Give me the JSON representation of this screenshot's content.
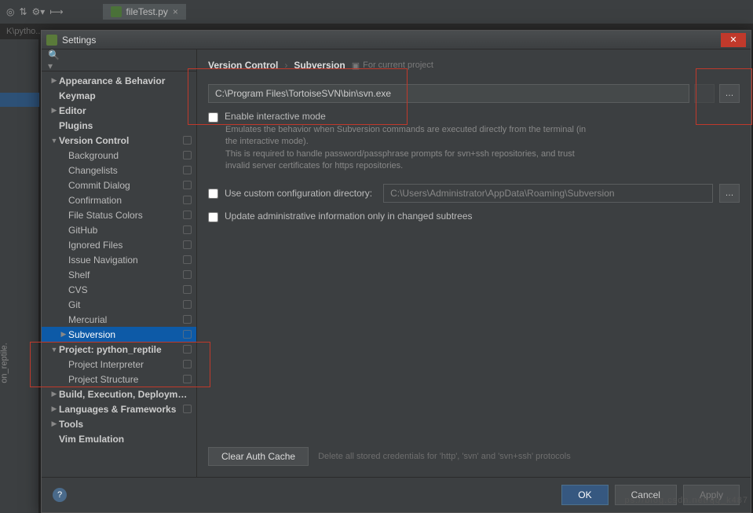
{
  "top": {
    "file_tab": "fileTest.py",
    "breadcrumb_partial": "K\\pytho..."
  },
  "gutter_label": "on_reptile.",
  "dialog": {
    "title": "Settings",
    "search_placeholder": "",
    "breadcrumb": {
      "root": "Version Control",
      "leaf": "Subversion",
      "tag": "For current project"
    },
    "svn_path": "C:\\Program Files\\TortoiseSVN\\bin\\svn.exe",
    "enable_interactive_label": "Enable interactive mode",
    "interactive_help": "Emulates the behavior when Subversion commands are executed directly from the terminal (in the interactive mode).\nThis is required to handle password/passphrase prompts for svn+ssh repositories, and trust invalid server certificates for https repositories.",
    "use_custom_dir_label": "Use custom configuration directory:",
    "custom_dir_value": "C:\\Users\\Administrator\\AppData\\Roaming\\Subversion",
    "update_admin_label": "Update administrative information only in changed subtrees",
    "clear_auth_btn": "Clear Auth Cache",
    "clear_auth_desc": "Delete all stored credentials for 'http', 'svn' and 'svn+ssh' protocols",
    "ok": "OK",
    "cancel": "Cancel",
    "apply": "Apply"
  },
  "tree": [
    {
      "label": "Appearance & Behavior",
      "indent": 0,
      "arrow": "closed",
      "bold": true
    },
    {
      "label": "Keymap",
      "indent": 0,
      "arrow": "none",
      "bold": true
    },
    {
      "label": "Editor",
      "indent": 0,
      "arrow": "closed",
      "bold": true
    },
    {
      "label": "Plugins",
      "indent": 0,
      "arrow": "none",
      "bold": true
    },
    {
      "label": "Version Control",
      "indent": 0,
      "arrow": "open",
      "bold": true,
      "proj": true
    },
    {
      "label": "Background",
      "indent": 1,
      "arrow": "none",
      "proj": true
    },
    {
      "label": "Changelists",
      "indent": 1,
      "arrow": "none",
      "proj": true
    },
    {
      "label": "Commit Dialog",
      "indent": 1,
      "arrow": "none",
      "proj": true
    },
    {
      "label": "Confirmation",
      "indent": 1,
      "arrow": "none",
      "proj": true
    },
    {
      "label": "File Status Colors",
      "indent": 1,
      "arrow": "none",
      "proj": true
    },
    {
      "label": "GitHub",
      "indent": 1,
      "arrow": "none",
      "proj": true
    },
    {
      "label": "Ignored Files",
      "indent": 1,
      "arrow": "none",
      "proj": true
    },
    {
      "label": "Issue Navigation",
      "indent": 1,
      "arrow": "none",
      "proj": true
    },
    {
      "label": "Shelf",
      "indent": 1,
      "arrow": "none",
      "proj": true
    },
    {
      "label": "CVS",
      "indent": 1,
      "arrow": "none",
      "proj": true
    },
    {
      "label": "Git",
      "indent": 1,
      "arrow": "none",
      "proj": true
    },
    {
      "label": "Mercurial",
      "indent": 1,
      "arrow": "none",
      "proj": true
    },
    {
      "label": "Subversion",
      "indent": 1,
      "arrow": "closed",
      "proj": true,
      "selected": true
    },
    {
      "label": "Project: python_reptile",
      "indent": 0,
      "arrow": "open",
      "bold": true,
      "proj": true
    },
    {
      "label": "Project Interpreter",
      "indent": 1,
      "arrow": "none",
      "proj": true
    },
    {
      "label": "Project Structure",
      "indent": 1,
      "arrow": "none",
      "proj": true
    },
    {
      "label": "Build, Execution, Deployment",
      "indent": 0,
      "arrow": "closed",
      "bold": true
    },
    {
      "label": "Languages & Frameworks",
      "indent": 0,
      "arrow": "closed",
      "bold": true,
      "proj": true
    },
    {
      "label": "Tools",
      "indent": 0,
      "arrow": "closed",
      "bold": true
    },
    {
      "label": "Vim Emulation",
      "indent": 0,
      "arrow": "none",
      "bold": true
    }
  ]
}
